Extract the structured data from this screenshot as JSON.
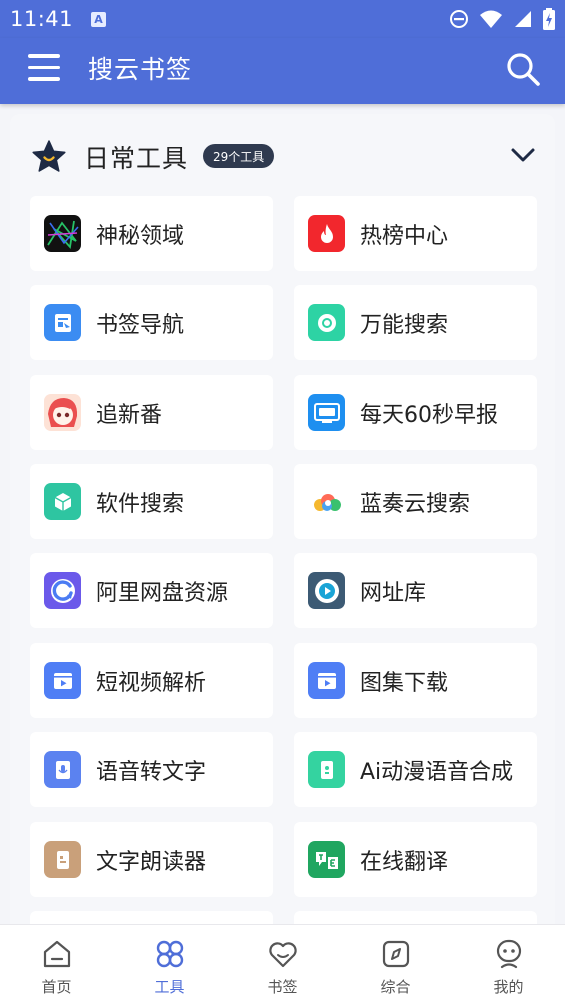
{
  "status_bar": {
    "time": "11:41",
    "badge": "A"
  },
  "app_bar": {
    "title": "搜云书签"
  },
  "section": {
    "title": "日常工具",
    "count_badge": "29个工具"
  },
  "tools": [
    {
      "label": "神秘领域",
      "icon": "abstract-lines-icon"
    },
    {
      "label": "热榜中心",
      "icon": "flame-icon"
    },
    {
      "label": "书签导航",
      "icon": "bookmark-page-icon"
    },
    {
      "label": "万能搜索",
      "icon": "search-bubble-icon"
    },
    {
      "label": "追新番",
      "icon": "anime-avatar-icon"
    },
    {
      "label": "每天60秒早报",
      "icon": "news-screen-icon"
    },
    {
      "label": "软件搜索",
      "icon": "package-cube-icon"
    },
    {
      "label": "蓝奏云搜索",
      "icon": "cloud-icon"
    },
    {
      "label": "阿里网盘资源",
      "icon": "circular-arrow-icon"
    },
    {
      "label": "网址库",
      "icon": "play-disc-icon"
    },
    {
      "label": "短视频解析",
      "icon": "video-clapper-icon"
    },
    {
      "label": "图集下载",
      "icon": "image-clapper-icon"
    },
    {
      "label": "语音转文字",
      "icon": "voice-doc-icon"
    },
    {
      "label": "Ai动漫语音合成",
      "icon": "ai-voice-doc-icon"
    },
    {
      "label": "文字朗读器",
      "icon": "reader-doc-icon"
    },
    {
      "label": "在线翻译",
      "icon": "translate-icon"
    }
  ],
  "tab_bar": [
    {
      "label": "首页",
      "icon": "home-icon",
      "active": false
    },
    {
      "label": "工具",
      "icon": "tools-clover-icon",
      "active": true
    },
    {
      "label": "书签",
      "icon": "heart-icon",
      "active": false
    },
    {
      "label": "综合",
      "icon": "compass-icon",
      "active": false
    },
    {
      "label": "我的",
      "icon": "profile-icon",
      "active": false
    }
  ],
  "colors": {
    "primary": "#4f6ed8",
    "badge_bg": "#2f3a4f",
    "background": "#f4f5f9"
  }
}
